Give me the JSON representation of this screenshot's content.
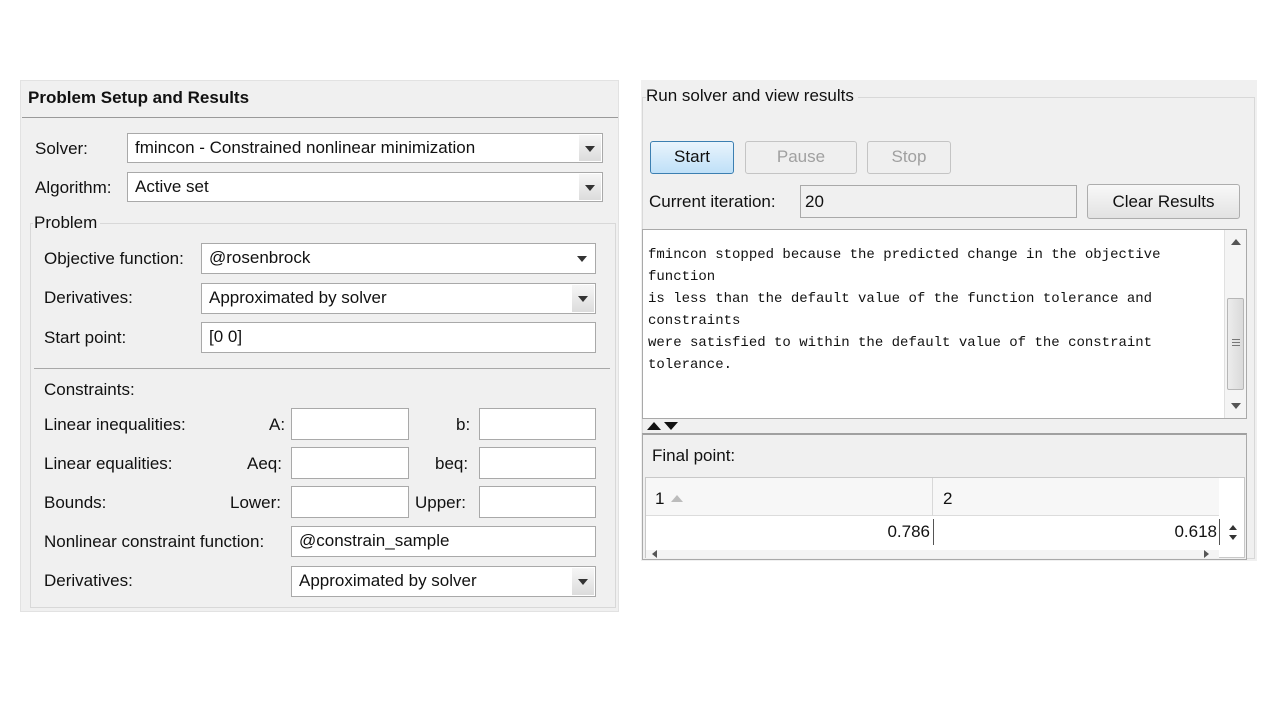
{
  "left_panel": {
    "title": "Problem Setup and Results",
    "solver_label": "Solver:",
    "solver_value": "fmincon - Constrained nonlinear minimization",
    "algorithm_label": "Algorithm:",
    "algorithm_value": "Active set",
    "problem_group": "Problem",
    "objective_label": "Objective function:",
    "objective_value": "@rosenbrock",
    "derivatives_label": "Derivatives:",
    "derivatives_value": "Approximated by solver",
    "start_label": "Start point:",
    "start_value": "[0 0]",
    "constraints_label": "Constraints:",
    "lin_ineq_label": "Linear inequalities:",
    "a_label": "A:",
    "b_label": "b:",
    "lin_eq_label": "Linear equalities:",
    "aeq_label": "Aeq:",
    "beq_label": "beq:",
    "bounds_label": "Bounds:",
    "lower_label": "Lower:",
    "upper_label": "Upper:",
    "nonlin_label": "Nonlinear constraint function:",
    "nonlin_value": "@constrain_sample",
    "nonlin_deriv_label": "Derivatives:",
    "nonlin_deriv_value": "Approximated by solver"
  },
  "right_panel": {
    "title": "Run solver and view results",
    "start_button": "Start",
    "pause_button": "Pause",
    "stop_button": "Stop",
    "iteration_label": "Current iteration:",
    "iteration_value": "20",
    "clear_button": "Clear Results",
    "message_lines": [
      "fmincon stopped because the predicted change in the objective",
      "function",
      "is less than the default value of the function tolerance and",
      "constraints",
      "were satisfied to within the default value of the constraint",
      "tolerance."
    ],
    "final_point_label": "Final point:",
    "table": {
      "headers": [
        "1",
        "2"
      ],
      "values": [
        "0.786",
        "0.618"
      ]
    }
  }
}
